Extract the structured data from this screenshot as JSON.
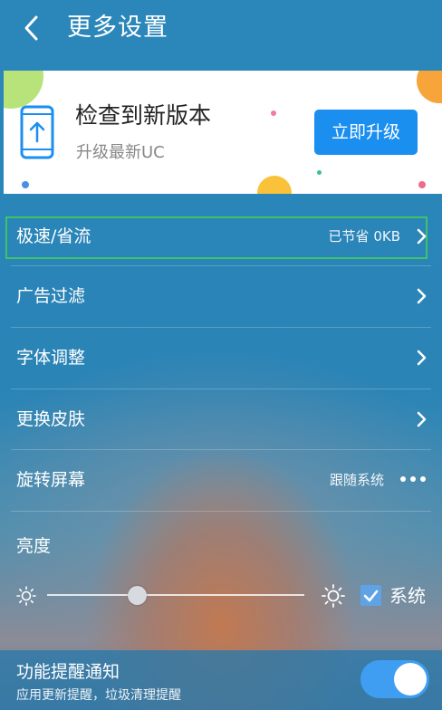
{
  "header": {
    "title": "更多设置",
    "back_icon": "chevron-left-icon"
  },
  "banner": {
    "title": "检查到新版本",
    "subtitle": "升级最新UC",
    "button_label": "立即升级",
    "icon": "phone-upload-icon",
    "accent": "#1b8ff0"
  },
  "settings": {
    "items": [
      {
        "label": "极速/省流",
        "value": "已节省 0KB",
        "icon": "chevron-right-icon"
      },
      {
        "label": "广告过滤",
        "icon": "chevron-right-icon"
      },
      {
        "label": "字体调整",
        "icon": "chevron-right-icon"
      },
      {
        "label": "更换皮肤",
        "icon": "chevron-right-icon"
      },
      {
        "label": "旋转屏幕",
        "value": "跟随系统",
        "icon": "more-dots-icon"
      }
    ]
  },
  "brightness": {
    "label": "亮度",
    "level": 0.35,
    "system_label": "系统",
    "system_checked": true
  },
  "notification": {
    "title": "功能提醒通知",
    "subtitle": "应用更新提醒，垃圾清理提醒",
    "enabled": true
  },
  "colors": {
    "background": "#2a86b8",
    "highlight_border": "#3fc36a",
    "toggle_on": "#3f9ef2"
  }
}
